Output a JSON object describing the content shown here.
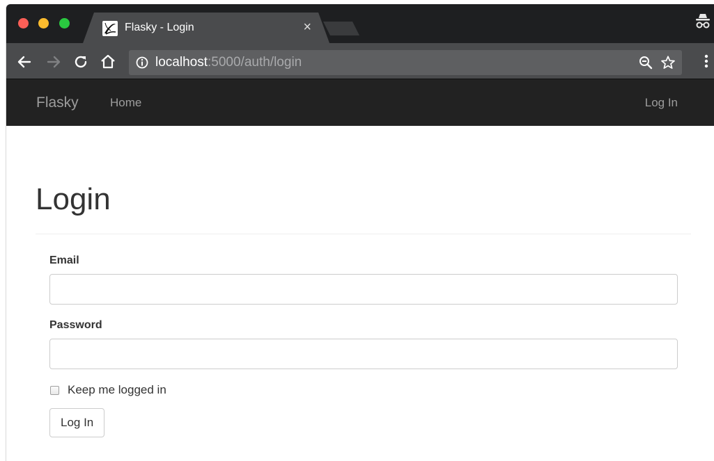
{
  "browser": {
    "tab": {
      "title": "Flasky - Login",
      "close_label": "×"
    },
    "address_bar": {
      "url_host": "localhost",
      "url_rest": ":5000/auth/login"
    },
    "icons": {
      "back": "arrow-left-icon",
      "forward": "arrow-right-icon",
      "reload": "reload-icon",
      "home": "home-icon",
      "site_info": "info-icon",
      "zoom": "zoom-out-icon",
      "bookmark": "star-icon",
      "menu": "more-vert-icon",
      "incognito": "incognito-icon"
    },
    "colors": {
      "tabstrip": "#1e1f21",
      "toolbar": "#4a4b4d",
      "omnibox": "#5e5f61"
    }
  },
  "navbar": {
    "brand": "Flasky",
    "links": [
      {
        "label": "Home"
      }
    ],
    "right_link": "Log In",
    "colors": {
      "background": "#222222",
      "text": "#9d9d9d"
    }
  },
  "page": {
    "heading": "Login",
    "form": {
      "email": {
        "label": "Email",
        "value": "",
        "placeholder": ""
      },
      "password": {
        "label": "Password",
        "value": "",
        "placeholder": ""
      },
      "remember_me": {
        "label": "Keep me logged in",
        "checked": false
      },
      "submit_label": "Log In"
    }
  }
}
